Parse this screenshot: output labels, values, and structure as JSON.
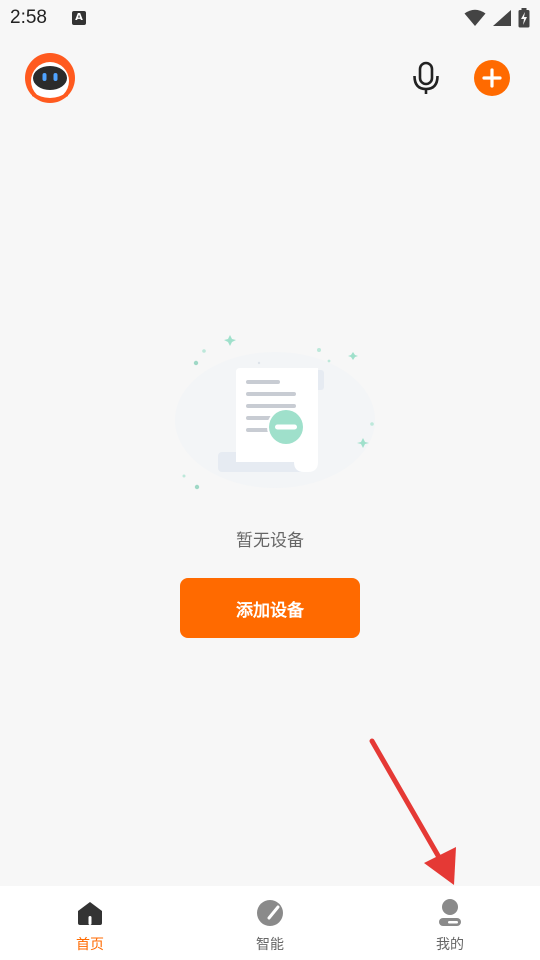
{
  "status_bar": {
    "time": "2:58",
    "notification_letter": "A",
    "icons": [
      "wifi-icon",
      "signal-icon",
      "battery-charging-icon"
    ]
  },
  "header": {
    "avatar_icon": "robot-avatar-icon",
    "mic_icon": "microphone-icon",
    "add_icon": "plus-circle-icon"
  },
  "empty_state": {
    "illustration_icon": "empty-document-icon",
    "message": "暂无设备",
    "add_button_label": "添加设备"
  },
  "tab_bar": {
    "tabs": [
      {
        "label": "首页",
        "icon": "home-icon",
        "active": true
      },
      {
        "label": "智能",
        "icon": "smart-icon",
        "active": false
      },
      {
        "label": "我的",
        "icon": "profile-icon",
        "active": false
      }
    ]
  },
  "colors": {
    "accent": "#ff6a00",
    "background": "#f7f7f7",
    "annotation": "#e53935"
  }
}
